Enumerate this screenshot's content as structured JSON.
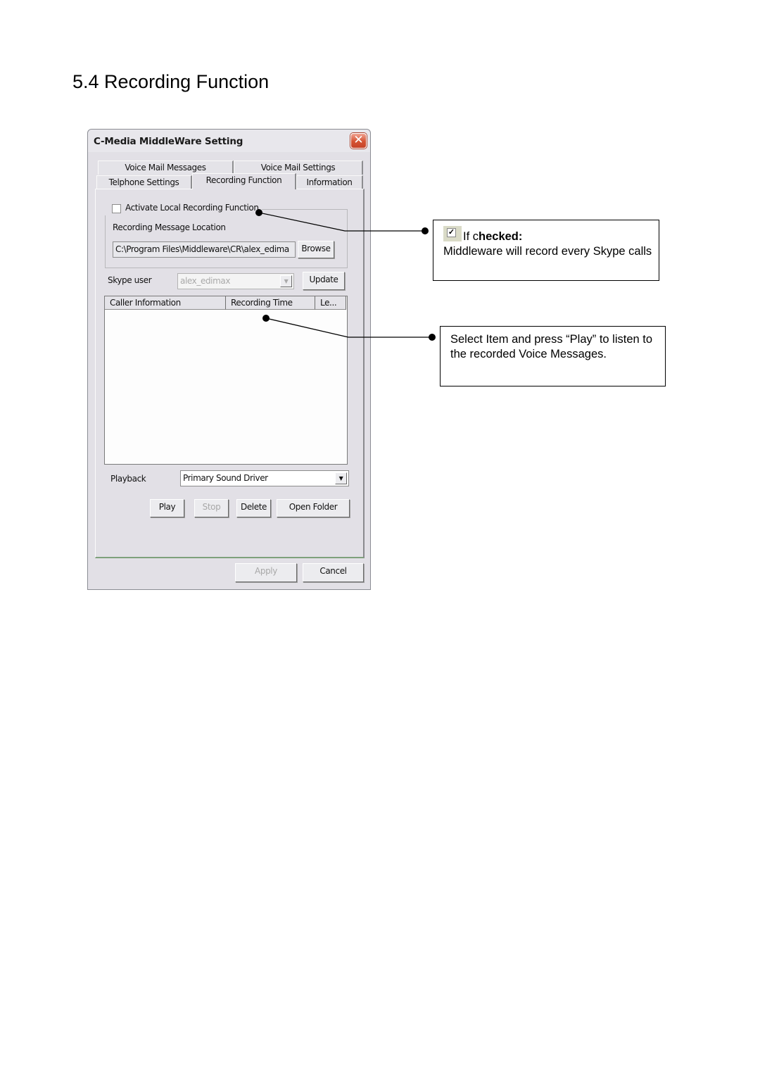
{
  "page": {
    "heading": "5.4 Recording Function"
  },
  "window": {
    "title": "C-Media MiddleWare Setting",
    "close_icon": "close-x-icon",
    "tabs_row1": [
      {
        "label": "Voice Mail Messages"
      },
      {
        "label": "Voice Mail Settings"
      }
    ],
    "tabs_row2": [
      {
        "label": "Telphone Settings"
      },
      {
        "label": "Recording Function",
        "active": true
      },
      {
        "label": "Information"
      }
    ],
    "recording": {
      "activate_label": "Activate Local Recording Function",
      "activate_checked": false,
      "location_label": "Recording Message Location",
      "location_value": "C:\\Program Files\\Middleware\\CR\\alex_edima",
      "browse_label": "Browse"
    },
    "skype": {
      "label": "Skype user",
      "value": "alex_edimax",
      "update_label": "Update"
    },
    "list": {
      "columns": [
        "Caller Information",
        "Recording Time",
        "Le..."
      ],
      "rows": []
    },
    "playback": {
      "label": "Playback",
      "value": "Primary Sound Driver"
    },
    "buttons": {
      "play": "Play",
      "stop": "Stop",
      "delete": "Delete",
      "open_folder": "Open Folder",
      "apply": "Apply",
      "cancel": "Cancel"
    }
  },
  "callouts": [
    {
      "heading_prefix": "If c",
      "heading_bold": "hecked:",
      "text": "Middleware will record every Skype calls"
    },
    {
      "text": "Select Item and press “Play” to listen to the recorded Voice Messages."
    }
  ]
}
